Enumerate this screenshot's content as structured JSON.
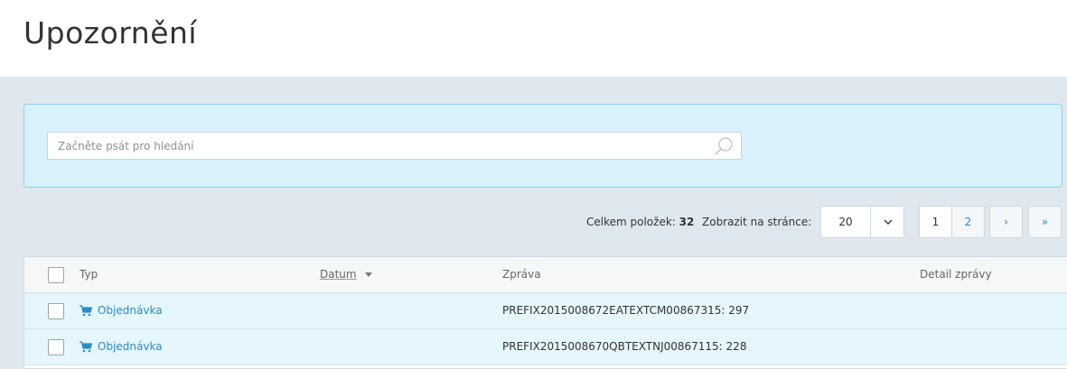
{
  "page": {
    "title": "Upozornění"
  },
  "search": {
    "placeholder": "Začněte psát pro hledání"
  },
  "pager": {
    "total_label": "Celkem položek:",
    "total_value": "32",
    "per_page_label": "Zobrazit na stránce:",
    "per_page_value": "20",
    "pages": [
      "1",
      "2"
    ],
    "next_label": "›",
    "last_label": "»",
    "current_page": "1"
  },
  "table": {
    "columns": {
      "type": "Typ",
      "date": "Datum",
      "message": "Zpráva",
      "detail": "Detail zprávy"
    },
    "rows": [
      {
        "type": "Objednávka",
        "type_icon": "cart-icon",
        "date": "",
        "message": "PREFIX2015008672EATEXTCM00867315: 297",
        "detail": ""
      },
      {
        "type": "Objednávka",
        "type_icon": "cart-icon",
        "date": "",
        "message": "PREFIX2015008670QBTEXTNJ00867115: 228",
        "detail": ""
      }
    ]
  },
  "colors": {
    "accent": "#2a8bc8",
    "search_panel_bg": "#d8f1fb",
    "row_bg": "#e5f6fc",
    "page_bg": "#e0e8ef"
  }
}
